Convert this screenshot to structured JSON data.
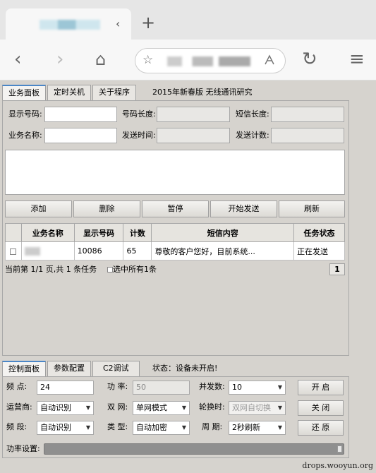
{
  "browser": {
    "tab_close": "‹",
    "new_tab": "+",
    "back": "‹",
    "forward": "›",
    "home": "⌂",
    "star": "☆",
    "reload": "↻",
    "menu": "≡"
  },
  "app": {
    "top_tabs": [
      "业务面板",
      "定时关机",
      "关于程序"
    ],
    "top_title": "2015年新春版 无线通讯研究",
    "fields": {
      "display_number": {
        "label": "显示号码:",
        "value": ""
      },
      "number_length": {
        "label": "号码长度:",
        "value": ""
      },
      "sms_length": {
        "label": "短信长度:",
        "value": ""
      },
      "service_name": {
        "label": "业务名称:",
        "value": ""
      },
      "send_time": {
        "label": "发送时间:",
        "value": ""
      },
      "send_count": {
        "label": "发送计数:",
        "value": ""
      }
    },
    "actions": [
      "添加",
      "删除",
      "暂停",
      "开始发送",
      "刷新"
    ],
    "table": {
      "headers": [
        "",
        "业务名称",
        "显示号码",
        "计数",
        "短信内容",
        "任务状态"
      ],
      "rows": [
        {
          "name": "",
          "number": "10086",
          "count": "65",
          "content": "尊敬的客户您好，目前系统...",
          "status": "正在发送"
        }
      ]
    },
    "pager_text": "当前第 1/1 页,共 1 条任务",
    "select_all": "选中所有1条",
    "page_number": "1",
    "bottom_tabs": [
      "控制面板",
      "参数配置",
      "C2调试"
    ],
    "status_text": "状态：设备未开启!",
    "controls": {
      "freq": {
        "label": "频  点:",
        "value": "24"
      },
      "power": {
        "label": "功  率:",
        "value": "50"
      },
      "concurrency": {
        "label": "并发数:",
        "value": "10"
      },
      "operator": {
        "label": "运营商:",
        "value": "自动识别"
      },
      "network": {
        "label": "双  网:",
        "value": "单网模式"
      },
      "switch_time": {
        "label": "轮换时:",
        "value": "双网自切换"
      },
      "band": {
        "label": "频  段:",
        "value": "自动识别"
      },
      "type": {
        "label": "类  型:",
        "value": "自动加密"
      },
      "period": {
        "label": "周  期:",
        "value": "2秒刷新"
      },
      "power_setting": {
        "label": "功率设置:"
      }
    },
    "buttons": {
      "open": "开 启",
      "close": "关 闭",
      "restore": "还 原"
    },
    "power_level_percent": 100
  },
  "watermark": "drops.wooyun.org"
}
